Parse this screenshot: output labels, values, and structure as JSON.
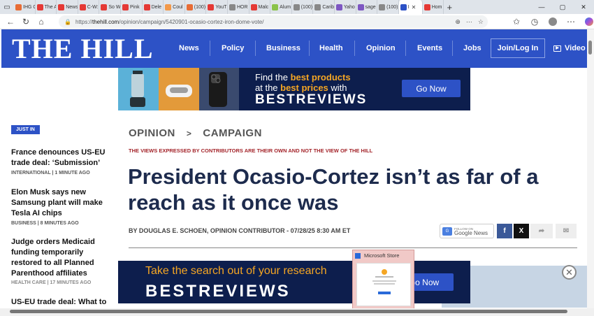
{
  "browser": {
    "tabs": [
      {
        "label": "IHG C",
        "color": "#e86c35"
      },
      {
        "label": "The A",
        "color": "#e53935"
      },
      {
        "label": "News:",
        "color": "#e53935"
      },
      {
        "label": "C-W:",
        "color": "#e53935"
      },
      {
        "label": "So W",
        "color": "#e53935"
      },
      {
        "label": "Pink",
        "color": "#e53935"
      },
      {
        "label": "Dele",
        "color": "#e53935"
      },
      {
        "label": "Coul",
        "color": "#f2994a"
      },
      {
        "label": "(100)",
        "color": "#e86c35"
      },
      {
        "label": "YouT",
        "color": "#e53935"
      },
      {
        "label": "HOR",
        "color": "#888888"
      },
      {
        "label": "Malc",
        "color": "#e53935"
      },
      {
        "label": "Alum",
        "color": "#8bc34a"
      },
      {
        "label": "(100)",
        "color": "#888888"
      },
      {
        "label": "Carib",
        "color": "#888888"
      },
      {
        "label": "Yaho",
        "color": "#7e57c2"
      },
      {
        "label": "sage",
        "color": "#7e57c2"
      },
      {
        "label": "(100)",
        "color": "#888888"
      },
      {
        "label": "I",
        "color": "#2d52c6"
      },
      {
        "label": "Hom",
        "color": "#e53935"
      }
    ],
    "url_prefix": "https://",
    "url_host": "thehill.com",
    "url_path": "/opinion/campaign/5420901-ocasio-cortez-iron-dome-vote/"
  },
  "site": {
    "logo": "THE HILL",
    "nav": [
      "News",
      "Policy",
      "Business",
      "Health",
      "Opinion",
      "Events",
      "Jobs"
    ],
    "login": "Join/Log In",
    "video": "Video"
  },
  "top_ad": {
    "line1_prefix": "Find the ",
    "line1_bold": "best products",
    "line2_prefix": "at the ",
    "line2_bold": "best prices",
    "line2_suffix": " with",
    "brand": "BESTREVIEWS",
    "cta": "Go Now"
  },
  "sidebar": {
    "badge": "JUST IN",
    "items": [
      {
        "title": "France denounces US-EU trade deal: ‘Submission’",
        "meta": "INTERNATIONAL | 1 MINUTE AGO"
      },
      {
        "title": "Elon Musk says new Samsung plant will make Tesla AI chips",
        "meta": "BUSINESS | 8 MINUTES AGO"
      },
      {
        "title": "Judge orders Medicaid funding temporarily restored to all Planned Parenthood affiliates",
        "meta": "HEALTH CARE | 17 MINUTES AGO"
      },
      {
        "title": "US-EU trade deal: What to",
        "meta": ""
      }
    ]
  },
  "article": {
    "section": "OPINION",
    "crumb_sep": ">",
    "subsection": "CAMPAIGN",
    "disclaimer": "THE VIEWS EXPRESSED BY CONTRIBUTORS ARE THEIR OWN AND NOT THE VIEW OF THE HILL",
    "title": "President Ocasio-Cortez isn’t as far of a reach as it once was",
    "byline": "BY DOUGLAS E. SCHOEN, OPINION CONTRIBUTOR - 07/28/25 8:30 AM ET",
    "gnews_follow": "FOLLOW ON",
    "gnews_label": "Google News",
    "share_facebook": "f",
    "share_x": "X"
  },
  "bottom_ad": {
    "headline": "Take the search out of your research",
    "brand": "BESTREVIEWS",
    "cta": "Go Now"
  },
  "taskbar_preview": {
    "title": "Microsoft Store"
  }
}
